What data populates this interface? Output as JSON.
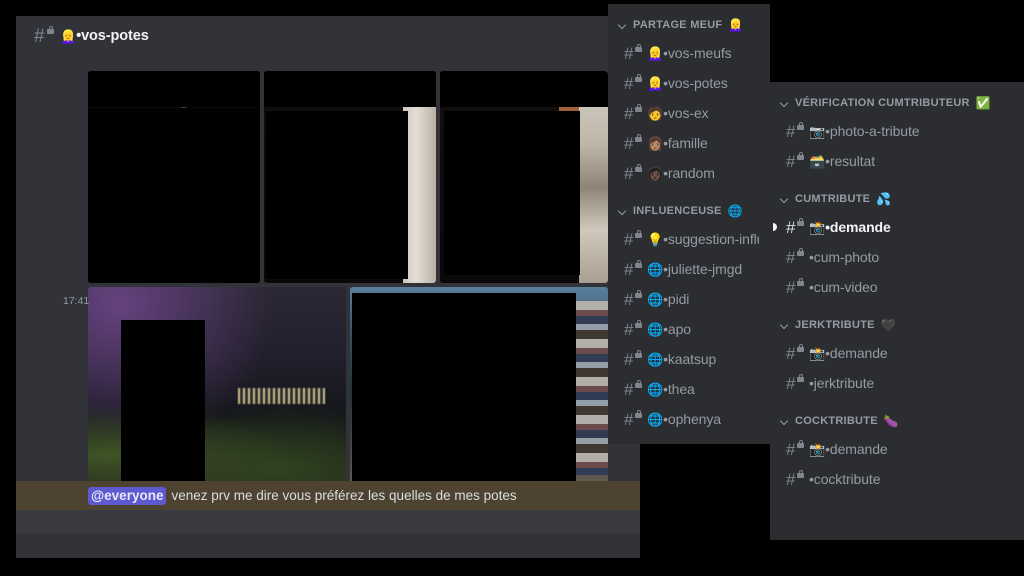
{
  "header": {
    "channel_name": "•vos-potes",
    "channel_emoji": "👱‍♀️",
    "icon": "hash-lock-icon"
  },
  "message": {
    "timestamp": "17:41",
    "mention": "@everyone",
    "text": "venez prv me dire vous préférez les quelles de mes potes"
  },
  "middle_panel": {
    "categories": [
      {
        "label": "PARTAGE MEUF",
        "emoji": "👱‍♀️",
        "channels": [
          {
            "emoji": "👱‍♀️",
            "name": "•vos-meufs",
            "active": false
          },
          {
            "emoji": "👱‍♀️",
            "name": "•vos-potes",
            "active": false
          },
          {
            "emoji": "🧑",
            "name": "•vos-ex",
            "active": false
          },
          {
            "emoji": "👩🏽",
            "name": "•famille",
            "active": false
          },
          {
            "emoji": "👩🏿",
            "name": "•random",
            "active": false
          }
        ]
      },
      {
        "label": "INFLUENCEUSE",
        "emoji": "🌐",
        "channels": [
          {
            "emoji": "💡",
            "name": "•suggestion-influ",
            "active": false,
            "truncated": true
          },
          {
            "emoji": "🌐",
            "name": "•juliette-jmgd",
            "active": false
          },
          {
            "emoji": "🌐",
            "name": "•pidi",
            "active": false
          },
          {
            "emoji": "🌐",
            "name": "•apo",
            "active": false
          },
          {
            "emoji": "🌐",
            "name": "•kaatsup",
            "active": false
          },
          {
            "emoji": "🌐",
            "name": "•thea",
            "active": false
          },
          {
            "emoji": "🌐",
            "name": "•ophenya",
            "active": false
          }
        ]
      }
    ]
  },
  "right_panel": {
    "categories": [
      {
        "label": "VÉRIFICATION CUMTRIBUTEUR",
        "emoji": "✅",
        "channels": [
          {
            "emoji": "📷",
            "name": "•photo-a-tribute",
            "active": false
          },
          {
            "emoji": "🗃️",
            "name": "•resultat",
            "active": false
          }
        ]
      },
      {
        "label": "CUMTRIBUTE",
        "emoji": "💦",
        "channels": [
          {
            "emoji": "📸",
            "name": "•demande",
            "active": true
          },
          {
            "emoji": "",
            "name": "•cum-photo",
            "active": false
          },
          {
            "emoji": "",
            "name": "•cum-video",
            "active": false
          }
        ]
      },
      {
        "label": "JERKTRIBUTE",
        "emoji": "🖤",
        "channels": [
          {
            "emoji": "📸",
            "name": "•demande",
            "active": false
          },
          {
            "emoji": "",
            "name": "•jerktribute",
            "active": false
          }
        ]
      },
      {
        "label": "COCKTRIBUTE",
        "emoji": "🍆",
        "channels": [
          {
            "emoji": "📸",
            "name": "•demande",
            "active": false
          },
          {
            "emoji": "",
            "name": "•cocktribute",
            "active": false
          }
        ]
      }
    ]
  },
  "attachments": {
    "row1": [
      {
        "name": "image-attachment-1",
        "scene": "sc-door"
      },
      {
        "name": "image-attachment-2",
        "scene": "sc-room"
      },
      {
        "name": "image-attachment-3",
        "scene": "sc-kitchen"
      }
    ],
    "row2": [
      {
        "name": "image-attachment-4",
        "scene": "sc-city"
      },
      {
        "name": "image-attachment-5",
        "scene": "sc-shelf"
      }
    ]
  },
  "colors": {
    "app_bg": "#313338",
    "panel_bg": "#2b2d31",
    "mention_bg": "#4d4330",
    "mention_pill": "#5d5ad0",
    "muted_text": "#949ba4",
    "active_text": "#f2f3f5"
  }
}
